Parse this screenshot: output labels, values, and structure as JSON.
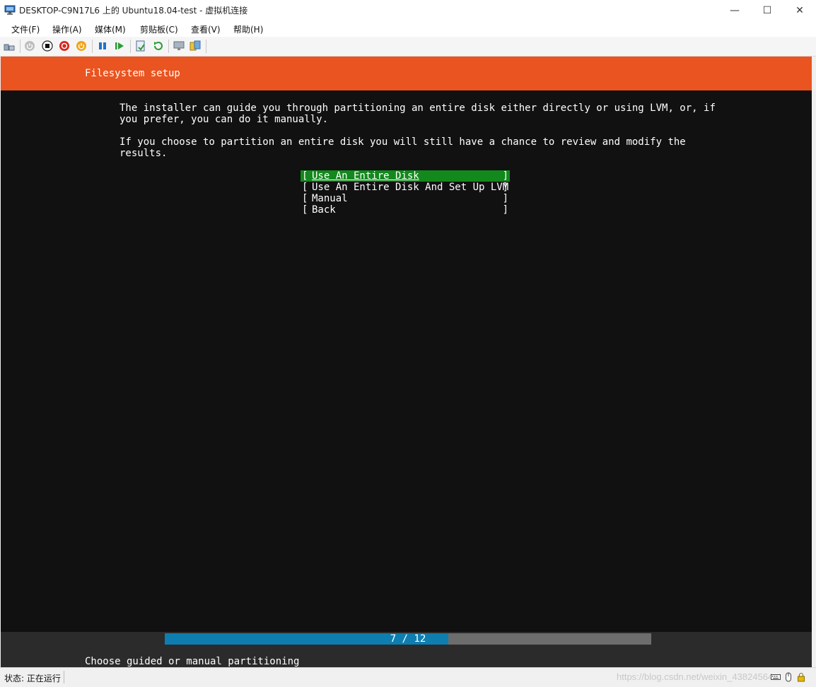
{
  "window": {
    "title": "DESKTOP-C9N17L6 上的 Ubuntu18.04-test - 虚拟机连接",
    "controls": {
      "minimize": "—",
      "maximize": "☐",
      "close": "✕"
    }
  },
  "menu": {
    "items": [
      {
        "label": "文件(F)"
      },
      {
        "label": "操作(A)"
      },
      {
        "label": "媒体(M)"
      },
      {
        "label": "剪贴板(C)"
      },
      {
        "label": "查看(V)"
      },
      {
        "label": "帮助(H)"
      }
    ]
  },
  "toolbar": {
    "icons": [
      "ctrl-alt-del-icon",
      "start-icon",
      "turn-off-icon",
      "shutdown-icon",
      "save-icon",
      "pause-icon",
      "resume-icon",
      "checkpoint-icon",
      "revert-icon",
      "enhanced-session-icon",
      "share-icon"
    ]
  },
  "vm": {
    "header_title": "Filesystem setup",
    "paragraph1": "The installer can guide you through partitioning an entire disk either directly or using LVM, or, if\nyou prefer, you can do it manually.",
    "paragraph2": "If you choose to partition an entire disk you will still have a chance to review and modify the\nresults.",
    "options": [
      {
        "label": "Use An Entire Disk",
        "selected": true
      },
      {
        "label": "Use An Entire Disk And Set Up LVM",
        "selected": false
      },
      {
        "label": "Manual",
        "selected": false
      },
      {
        "label": "Back",
        "selected": false
      }
    ],
    "progress": {
      "current": 7,
      "total": 12,
      "text": "7 / 12"
    },
    "status_line": "Choose guided or manual partitioning",
    "colors": {
      "header": "#e95420",
      "selected": "#13881d",
      "progress": "#0e7eb0"
    }
  },
  "statusbar": {
    "status": "状态: 正在运行",
    "watermark": "https://blog.csdn.net/weixin_43824564"
  }
}
